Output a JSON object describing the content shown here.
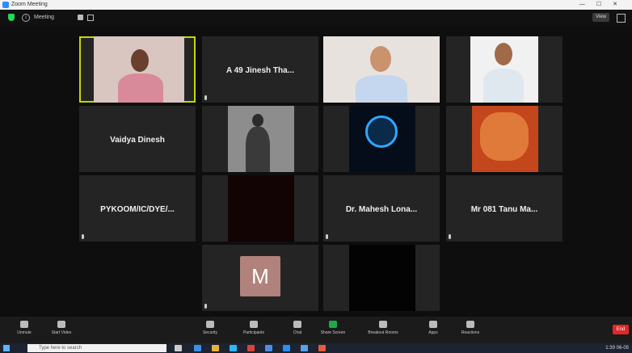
{
  "window": {
    "title": "Zoom Meeting"
  },
  "topbar": {
    "meeting_title": "Meeting",
    "view_label": "View",
    "info_glyph": "i"
  },
  "tiles": [
    {
      "id": "t1",
      "type": "video",
      "label": "",
      "active": true
    },
    {
      "id": "t2",
      "type": "name",
      "name": "A 49 Jinesh Tha..."
    },
    {
      "id": "t3",
      "type": "video",
      "label": ""
    },
    {
      "id": "t4",
      "type": "video",
      "label": ""
    },
    {
      "id": "t5",
      "type": "name",
      "name": "Vaidya Dinesh"
    },
    {
      "id": "t6",
      "type": "video",
      "label": ""
    },
    {
      "id": "t7",
      "type": "video",
      "label": ""
    },
    {
      "id": "t8",
      "type": "video",
      "label": ""
    },
    {
      "id": "t9",
      "type": "name",
      "name": "PYKOOM/IC/DYE/..."
    },
    {
      "id": "t10",
      "type": "video",
      "label": ""
    },
    {
      "id": "t11",
      "type": "name",
      "name": "Dr. Mahesh Lona..."
    },
    {
      "id": "t12",
      "type": "name",
      "name": "Mr 081 Tanu Ma..."
    },
    {
      "id": "t13",
      "type": "avatar",
      "initial": "M"
    },
    {
      "id": "t14",
      "type": "video",
      "label": ""
    }
  ],
  "toolbar": {
    "items": [
      {
        "name": "unmute",
        "label": "Unmute"
      },
      {
        "name": "start-video",
        "label": "Start Video"
      },
      {
        "name": "security",
        "label": "Security"
      },
      {
        "name": "participants",
        "label": "Participants"
      },
      {
        "name": "chat",
        "label": "Chat"
      },
      {
        "name": "share-screen",
        "label": "Share Screen"
      },
      {
        "name": "breakout-rooms",
        "label": "Breakout Rooms"
      },
      {
        "name": "apps",
        "label": "Apps"
      },
      {
        "name": "reactions",
        "label": "Reactions"
      }
    ],
    "end_label": "End"
  },
  "taskbar": {
    "search_placeholder": "Type here to search",
    "time": "1:39",
    "date": "06-05"
  },
  "colors": {
    "active_border": "#c5d800",
    "end": "#e02828",
    "tile_bg": "#242424"
  }
}
